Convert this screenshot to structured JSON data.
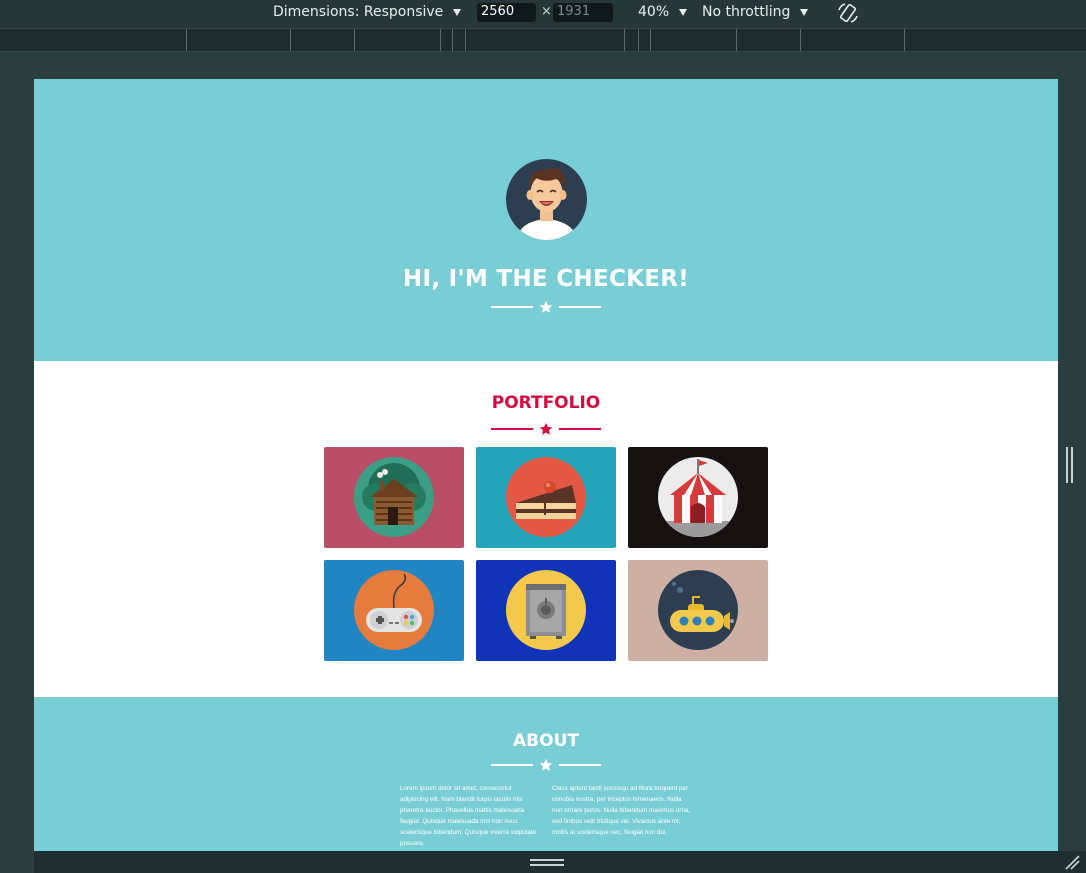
{
  "devtools": {
    "dimensions_label": "Dimensions: Responsive",
    "width_value": "2560",
    "height_placeholder": "1931",
    "times_symbol": "×",
    "zoom_label": "40%",
    "throttle_label": "No throttling",
    "rotate_icon": "rotate-icon"
  },
  "page": {
    "hero_title": "HI, I'M THE CHECKER!",
    "portfolio_title": "PORTFOLIO",
    "about_title": "ABOUT",
    "about_left": "Lorem ipsum dolor sit amet, consectetur adipiscing elit. Nam blandit turpis iaculis nisl pharetra auctor. Phasellus mattis malesuada feugiat. Quisque malesuada orci non risus scelerisque bibendum. Quisque viverra vulputate posuere.",
    "about_right": "Class aptent taciti sociosqu ad litora torquent per conubia nostra, per inceptos himenaeos. Nulla non ornare purus. Nulla bibendum maximus urna, sed finibus velit tristique vel. Vivamus ante mi, mollis at scelerisque nec, feugiat non dui.",
    "portfolio_items": [
      {
        "icon": "cabin-icon",
        "bg": "#b94e66",
        "circle": "#3d9e87"
      },
      {
        "icon": "cake-icon",
        "bg": "#24a4b9",
        "circle": "#e25845"
      },
      {
        "icon": "circus-tent-icon",
        "bg": "#161212",
        "circle": "#ececec"
      },
      {
        "icon": "game-controller-icon",
        "bg": "#2184c3",
        "circle": "#e57b3d"
      },
      {
        "icon": "safe-icon",
        "bg": "#1033b7",
        "circle": "#f2c94c"
      },
      {
        "icon": "submarine-icon",
        "bg": "#cdb0a3",
        "circle": "#2c3e50"
      }
    ]
  },
  "colors": {
    "header_bg": "#79cdd4",
    "accent_red": "#d4093f",
    "white": "#ffffff",
    "devtools_bg": "#253739"
  }
}
